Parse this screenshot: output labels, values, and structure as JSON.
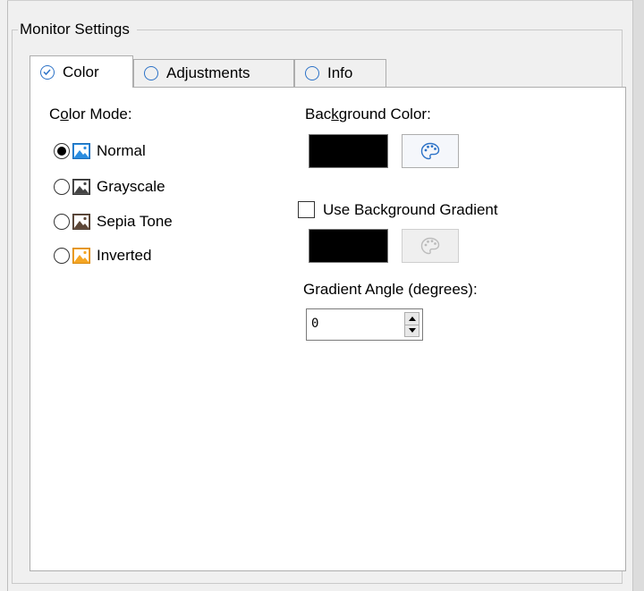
{
  "group": {
    "title": "Monitor Settings"
  },
  "tabs": [
    {
      "label": "Color",
      "active": true
    },
    {
      "label": "Adjustments",
      "active": false
    },
    {
      "label": "Info",
      "active": false
    }
  ],
  "color_mode": {
    "label_prefix": "C",
    "label_underlined": "o",
    "label_suffix": "lor Mode:",
    "options": [
      {
        "label": "Normal",
        "checked": true,
        "icon": "image-icon-blue"
      },
      {
        "label": "Grayscale",
        "checked": false,
        "icon": "image-icon-gray"
      },
      {
        "label": "Sepia Tone",
        "checked": false,
        "icon": "image-icon-sepia"
      },
      {
        "label": "Inverted",
        "checked": false,
        "icon": "image-icon-orange"
      }
    ]
  },
  "background": {
    "label_prefix": "Bac",
    "label_underlined": "k",
    "label_suffix": "ground Color:",
    "color": "#000000",
    "picker_icon": "palette-icon"
  },
  "gradient": {
    "checkbox_label": "Use Background Gradient",
    "checked": false,
    "color": "#000000",
    "picker_icon": "palette-icon",
    "angle_label": "Gradient Angle (degrees):",
    "angle_value": "0"
  }
}
